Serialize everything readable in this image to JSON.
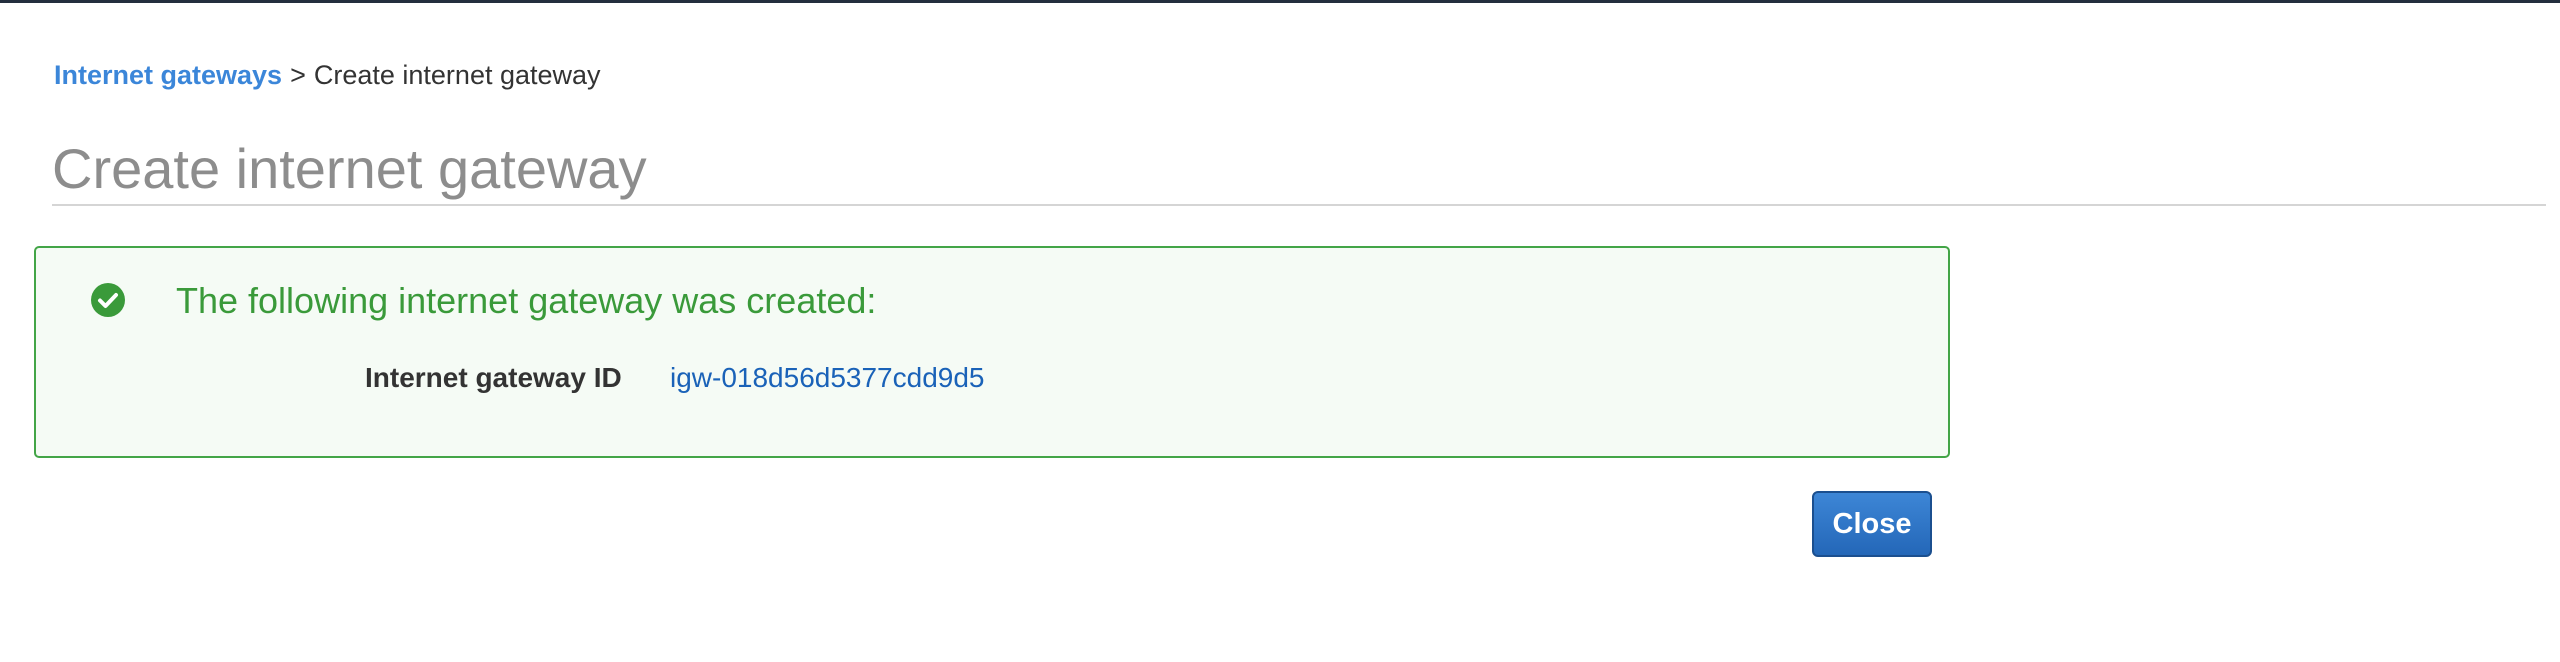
{
  "breadcrumb": {
    "parent": "Internet gateways",
    "separator": ">",
    "current": "Create internet gateway"
  },
  "page": {
    "title": "Create internet gateway"
  },
  "success": {
    "icon": "check-circle-icon",
    "heading": "The following internet gateway was created:",
    "label": "Internet gateway ID",
    "value": "igw-018d56d5377cdd9d5"
  },
  "actions": {
    "close_label": "Close"
  },
  "colors": {
    "link": "#3b86d9",
    "success": "#3a9a3a",
    "success_border": "#43a547",
    "primary_button": "#2467b8"
  }
}
